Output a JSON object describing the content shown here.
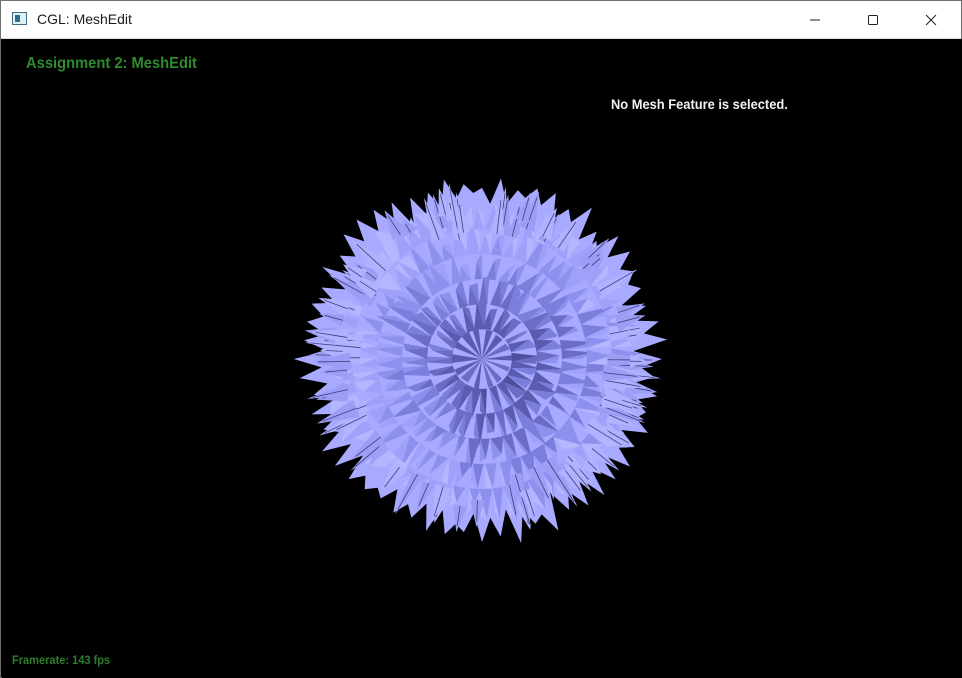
{
  "window": {
    "title": "CGL: MeshEdit",
    "controls": {
      "minimize_icon": "minimize-icon",
      "maximize_icon": "maximize-icon",
      "close_icon": "close-icon"
    }
  },
  "viewport": {
    "heading": "Assignment 2: MeshEdit",
    "selection_status": "No Mesh Feature is selected.",
    "framerate_text": "Framerate: 143 fps"
  },
  "colors": {
    "heading": "#2e8b2e",
    "status_text": "#f2f2f2",
    "background": "#000000",
    "mesh_light": "#a8aaff",
    "mesh_mid": "#8a8cee",
    "mesh_dark": "#5a5cb0"
  }
}
